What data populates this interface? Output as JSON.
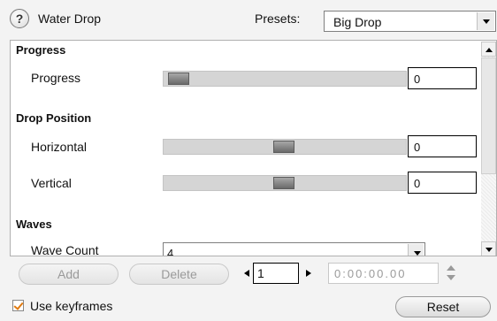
{
  "header": {
    "help_icon": "?",
    "title": "Water Drop",
    "presets_label": "Presets:",
    "presets_value": "Big Drop"
  },
  "panel": {
    "sections": {
      "progress": "Progress",
      "drop_position": "Drop Position",
      "waves": "Waves"
    },
    "params": {
      "progress": {
        "label": "Progress",
        "value": "0",
        "slider_fraction": 0.02
      },
      "horizontal": {
        "label": "Horizontal",
        "value": "0",
        "slider_fraction": 0.5
      },
      "vertical": {
        "label": "Vertical",
        "value": "0",
        "slider_fraction": 0.5
      },
      "wave_count": {
        "label": "Wave Count",
        "value": "4"
      }
    }
  },
  "footer": {
    "add_label": "Add",
    "delete_label": "Delete",
    "frame_value": "1",
    "time_value": "0:00:00.00",
    "use_keyframes_label": "Use keyframes",
    "use_keyframes_checked": true,
    "reset_label": "Reset"
  },
  "icons": {
    "help": "help-icon",
    "dropdown": "chevron-down-icon",
    "prev": "triangle-left-icon",
    "next": "triangle-right-icon",
    "spin": "spinner-icon"
  },
  "colors": {
    "checkmark": "#e07a10",
    "slider_track": "#d5d5d5",
    "slider_thumb": "#6a6a6a"
  }
}
